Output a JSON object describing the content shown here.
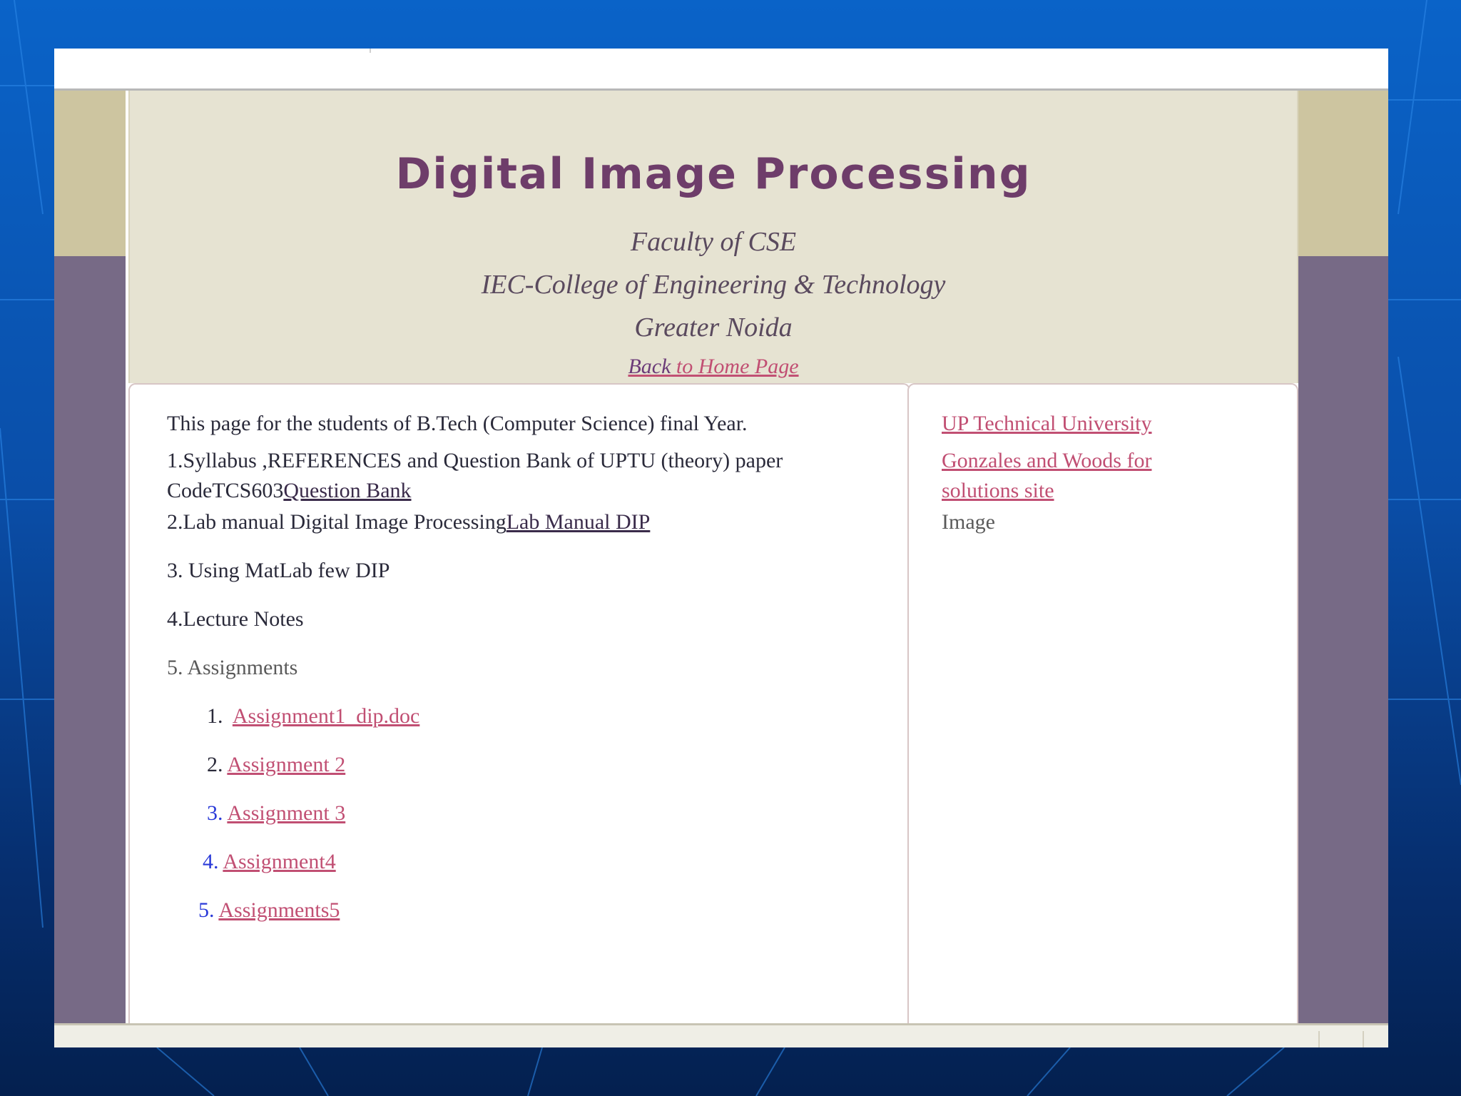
{
  "header": {
    "title": "Digital Image Processing",
    "faculty": "Faculty of  CSE",
    "college": "IEC-College of Engineering & Technology",
    "city": "Greater Noida",
    "home_link_part1": "Back",
    "home_link_part2": " to Home Page"
  },
  "main": {
    "intro": "This page for the students of B.Tech (Computer Science) final Year.",
    "item1_text_line1": "1.Syllabus ,REFERENCES and Question Bank of UPTU (theory) paper",
    "item1_text_line2": "CodeTCS603",
    "item1_link": "Question Bank",
    "item2_text": "2.Lab manual Digital Image Processing",
    "item2_link": "Lab Manual DIP",
    "item3_text": "3. Using MatLab few DIP",
    "item4_text": "4.Lecture Notes",
    "item5_text": "5. Assignments",
    "assignments": [
      {
        "num": "1.",
        "label": "Assignment1_dip.doc"
      },
      {
        "num": "2.",
        "label": "Assignment 2"
      },
      {
        "num": "3.",
        "label": "Assignment 3"
      },
      {
        "num": "4.",
        "label": "Assignment4"
      },
      {
        "num": "5.",
        "label": "Assignments5"
      }
    ]
  },
  "right": {
    "link1": "UP Technical University",
    "link2_line1": "Gonzales and Woods for",
    "link2_line2": "solutions site",
    "image_text": "Image"
  }
}
